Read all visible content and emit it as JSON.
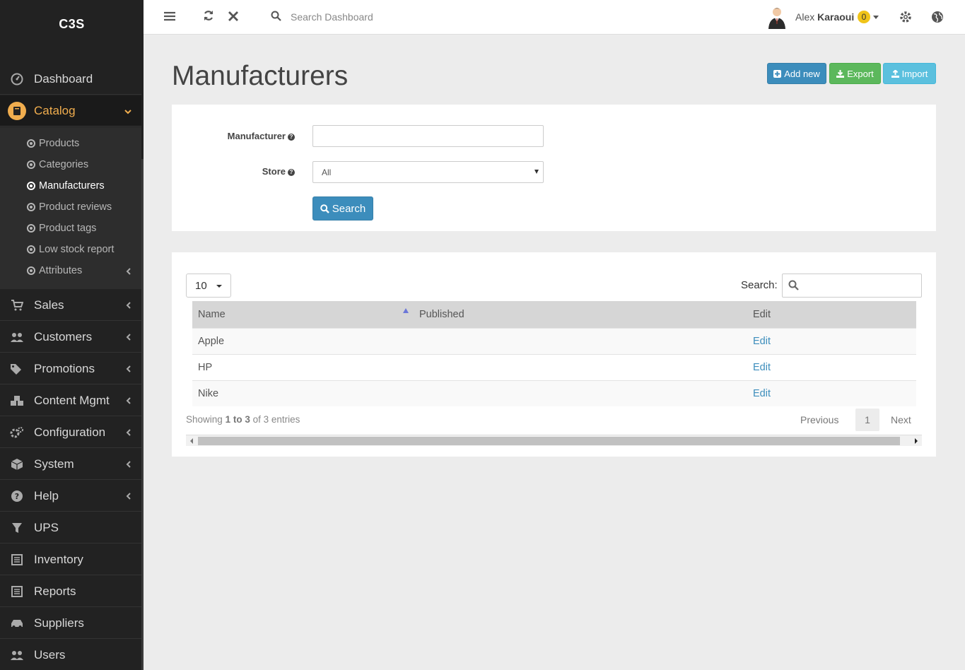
{
  "app": {
    "logo": "C3S"
  },
  "sidebar": {
    "items": [
      {
        "label": "Dashboard",
        "icon": "dashboard-icon"
      },
      {
        "label": "Catalog",
        "icon": "book-icon",
        "active": true
      },
      {
        "label": "Sales",
        "icon": "cart-icon"
      },
      {
        "label": "Customers",
        "icon": "users-icon"
      },
      {
        "label": "Promotions",
        "icon": "tags-icon"
      },
      {
        "label": "Content Mgmt",
        "icon": "cubes-icon"
      },
      {
        "label": "Configuration",
        "icon": "gears-icon"
      },
      {
        "label": "System",
        "icon": "cube-icon"
      },
      {
        "label": "Help",
        "icon": "question-icon"
      },
      {
        "label": "UPS",
        "icon": "filter-icon"
      },
      {
        "label": "Inventory",
        "icon": "list-icon"
      },
      {
        "label": "Reports",
        "icon": "report-icon"
      },
      {
        "label": "Suppliers",
        "icon": "car-icon"
      },
      {
        "label": "Users",
        "icon": "users-icon"
      }
    ],
    "catalog_sub": [
      {
        "label": "Products"
      },
      {
        "label": "Categories"
      },
      {
        "label": "Manufacturers",
        "current": true
      },
      {
        "label": "Product reviews"
      },
      {
        "label": "Product tags"
      },
      {
        "label": "Low stock report"
      },
      {
        "label": "Attributes"
      }
    ]
  },
  "topbar": {
    "search_placeholder": "Search Dashboard",
    "user_first": "Alex",
    "user_last": "Karaoui",
    "notification_count": "0"
  },
  "page": {
    "title": "Manufacturers",
    "add_label": "Add new",
    "export_label": "Export",
    "import_label": "Import"
  },
  "filter": {
    "manufacturer_label": "Manufacturer",
    "manufacturer_value": "",
    "store_label": "Store",
    "store_value": "All",
    "search_label": "Search"
  },
  "table": {
    "page_length": "10",
    "search_label": "Search:",
    "columns": [
      "Name",
      "Published",
      "Edit"
    ],
    "rows": [
      {
        "name": "Apple",
        "published": "",
        "edit": "Edit"
      },
      {
        "name": "HP",
        "published": "",
        "edit": "Edit"
      },
      {
        "name": "Nike",
        "published": "",
        "edit": "Edit"
      }
    ],
    "info_prefix": "Showing",
    "info_range": "1 to 3",
    "info_suffix": "of 3 entries",
    "prev_label": "Previous",
    "page_num": "1",
    "next_label": "Next"
  },
  "colors": {
    "accent": "#f0ad4e",
    "primary": "#3c8dbc",
    "success": "#5cb85c",
    "info": "#5bc0de"
  }
}
